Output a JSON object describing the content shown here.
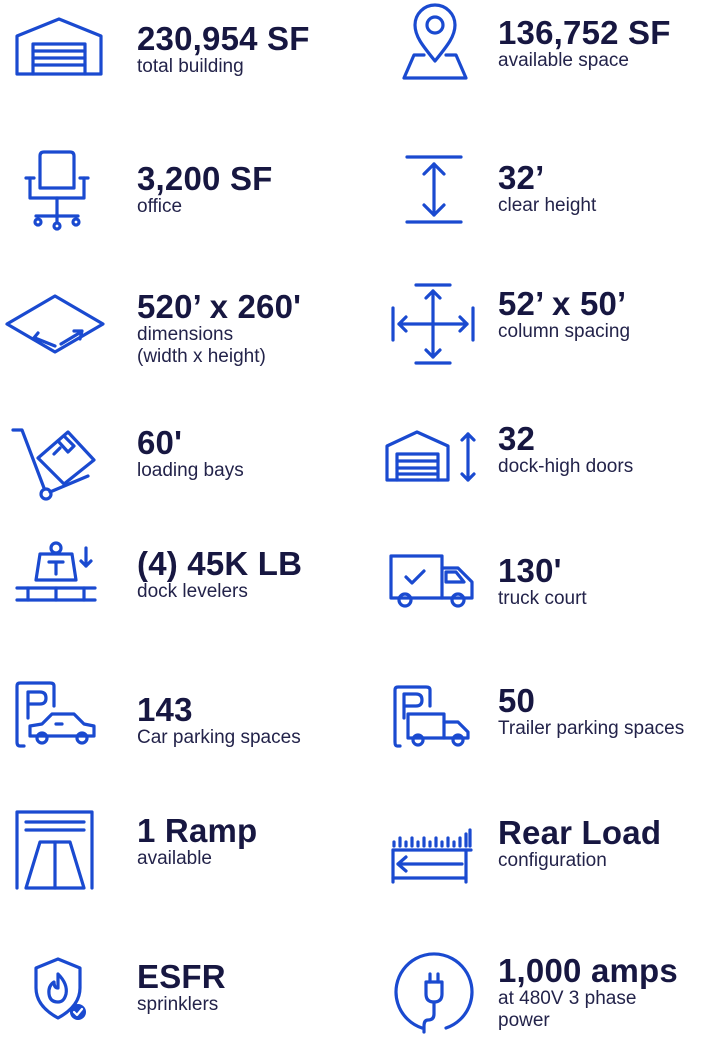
{
  "specs": [
    {
      "value": "230,954 SF",
      "label": "total building",
      "icon": "warehouse-icon"
    },
    {
      "value": "136,752 SF",
      "label": "available space",
      "icon": "map-pin-icon"
    },
    {
      "value": "3,200 SF",
      "label": "office",
      "icon": "office-chair-icon"
    },
    {
      "value": "32’",
      "label": "clear height",
      "icon": "vertical-height-icon"
    },
    {
      "value": "520’ x 260'",
      "label": "dimensions\n (width x height)",
      "icon": "floor-dimensions-icon"
    },
    {
      "value": "52’ x 50’",
      "label": "column spacing",
      "icon": "column-spacing-icon"
    },
    {
      "value": "60'",
      "label": "loading bays",
      "icon": "hand-truck-icon"
    },
    {
      "value": "32",
      "label": "dock-high doors",
      "icon": "dock-door-icon"
    },
    {
      "value": "(4) 45K LB",
      "label": "dock levelers",
      "icon": "weight-scale-icon"
    },
    {
      "value": "130'",
      "label": "truck court",
      "icon": "delivery-truck-icon"
    },
    {
      "value": "143",
      "label": "Car parking spaces",
      "icon": "car-parking-icon"
    },
    {
      "value": "50",
      "label": "Trailer  parking spaces",
      "icon": "trailer-parking-icon"
    },
    {
      "value": "1 Ramp",
      "label": "available",
      "icon": "ramp-icon"
    },
    {
      "value": "Rear Load",
      "label": "configuration",
      "icon": "rear-load-icon"
    },
    {
      "value": "ESFR",
      "label": "sprinklers",
      "icon": "fire-shield-icon"
    },
    {
      "value": "1,000 amps",
      "label": "at 480V 3 phase\npower",
      "icon": "power-plug-icon"
    }
  ],
  "colors": {
    "icon": "#1a4ad0",
    "text": "#171741"
  }
}
